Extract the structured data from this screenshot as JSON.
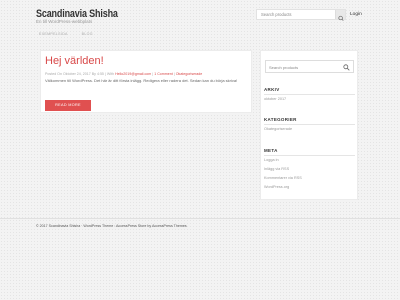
{
  "header": {
    "site_title": "Scandinavia Shisha",
    "site_description": "En till WordPress-webbplats",
    "search_placeholder": "Search products",
    "login_label": "Login"
  },
  "nav": [
    "EXEMPELSIDA",
    "BLOG"
  ],
  "post": {
    "title": "Hej världen!",
    "meta_prefix": "Posted On Oktober 24, 2017 By 4:55 | With",
    "meta_author": "Hello2019@gmail.com",
    "meta_sep1": " | ",
    "meta_comments": "1 Comment",
    "meta_sep2": " | ",
    "meta_category": "Okategoriserade",
    "excerpt": "Välkommen till WordPress. Det här är ditt första inlägg. Redigera eller radera det. Sedan kan du börja skriva!",
    "read_more": "READ MORE"
  },
  "sidebar": {
    "search_placeholder": "Search products",
    "arkiv_title": "ARKIV",
    "arkiv_items": [
      "oktober 2017"
    ],
    "kategorier_title": "KATEGORIER",
    "kategorier_items": [
      "Okategoriserade"
    ],
    "meta_title": "META",
    "meta_items": [
      "Logga in",
      "Inlägg via RSS",
      "Kommentarer via RSS",
      "WordPress.org"
    ]
  },
  "footer": {
    "text": "© 2017 Scandinavia Shisha · WordPress Theme : AccessPress Store by AccessPress Themes"
  },
  "colors": {
    "accent": "#e05050",
    "title_red": "#d84848"
  }
}
